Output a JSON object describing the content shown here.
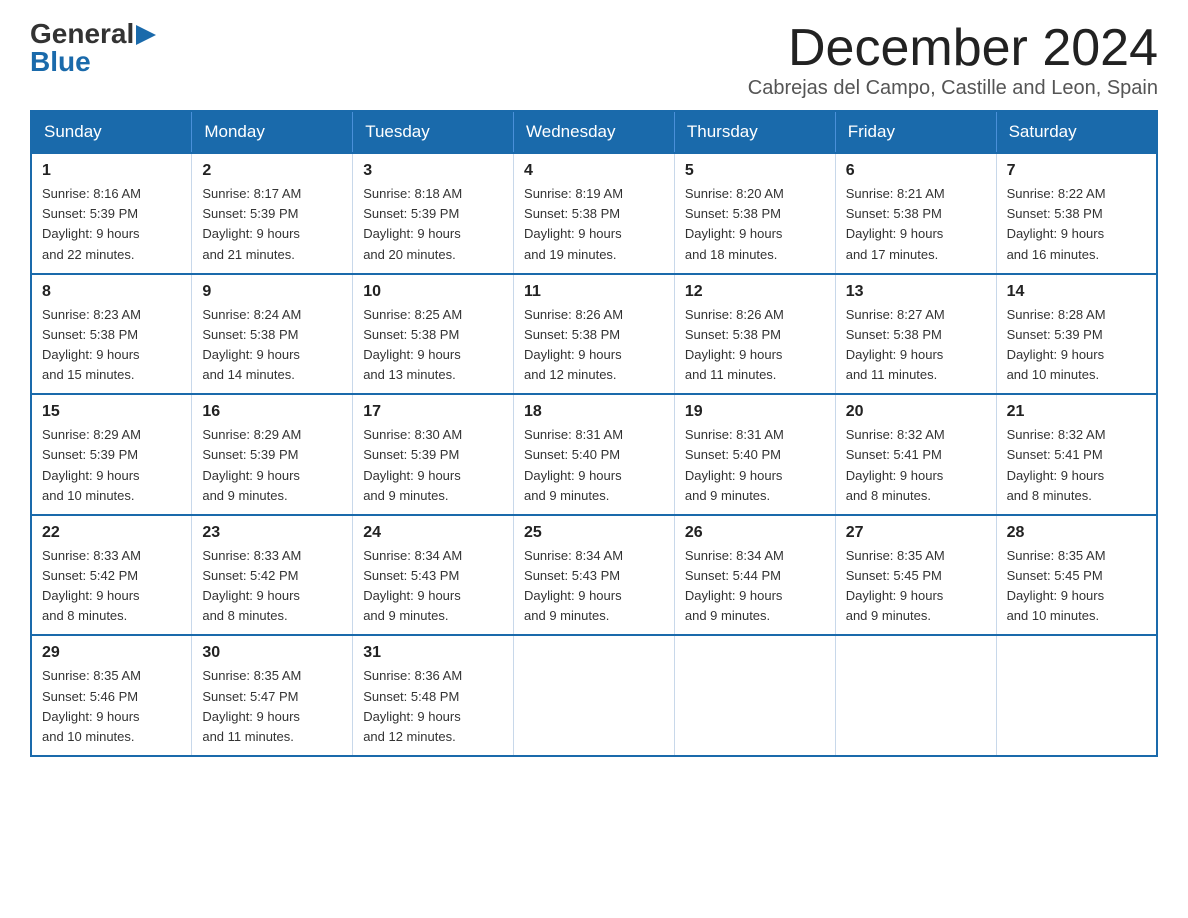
{
  "logo": {
    "general": "General",
    "blue": "Blue",
    "arrow": "▶"
  },
  "title": "December 2024",
  "location": "Cabrejas del Campo, Castille and Leon, Spain",
  "days_of_week": [
    "Sunday",
    "Monday",
    "Tuesday",
    "Wednesday",
    "Thursday",
    "Friday",
    "Saturday"
  ],
  "weeks": [
    [
      {
        "day": "1",
        "sunrise": "8:16 AM",
        "sunset": "5:39 PM",
        "daylight": "9 hours and 22 minutes."
      },
      {
        "day": "2",
        "sunrise": "8:17 AM",
        "sunset": "5:39 PM",
        "daylight": "9 hours and 21 minutes."
      },
      {
        "day": "3",
        "sunrise": "8:18 AM",
        "sunset": "5:39 PM",
        "daylight": "9 hours and 20 minutes."
      },
      {
        "day": "4",
        "sunrise": "8:19 AM",
        "sunset": "5:38 PM",
        "daylight": "9 hours and 19 minutes."
      },
      {
        "day": "5",
        "sunrise": "8:20 AM",
        "sunset": "5:38 PM",
        "daylight": "9 hours and 18 minutes."
      },
      {
        "day": "6",
        "sunrise": "8:21 AM",
        "sunset": "5:38 PM",
        "daylight": "9 hours and 17 minutes."
      },
      {
        "day": "7",
        "sunrise": "8:22 AM",
        "sunset": "5:38 PM",
        "daylight": "9 hours and 16 minutes."
      }
    ],
    [
      {
        "day": "8",
        "sunrise": "8:23 AM",
        "sunset": "5:38 PM",
        "daylight": "9 hours and 15 minutes."
      },
      {
        "day": "9",
        "sunrise": "8:24 AM",
        "sunset": "5:38 PM",
        "daylight": "9 hours and 14 minutes."
      },
      {
        "day": "10",
        "sunrise": "8:25 AM",
        "sunset": "5:38 PM",
        "daylight": "9 hours and 13 minutes."
      },
      {
        "day": "11",
        "sunrise": "8:26 AM",
        "sunset": "5:38 PM",
        "daylight": "9 hours and 12 minutes."
      },
      {
        "day": "12",
        "sunrise": "8:26 AM",
        "sunset": "5:38 PM",
        "daylight": "9 hours and 11 minutes."
      },
      {
        "day": "13",
        "sunrise": "8:27 AM",
        "sunset": "5:38 PM",
        "daylight": "9 hours and 11 minutes."
      },
      {
        "day": "14",
        "sunrise": "8:28 AM",
        "sunset": "5:39 PM",
        "daylight": "9 hours and 10 minutes."
      }
    ],
    [
      {
        "day": "15",
        "sunrise": "8:29 AM",
        "sunset": "5:39 PM",
        "daylight": "9 hours and 10 minutes."
      },
      {
        "day": "16",
        "sunrise": "8:29 AM",
        "sunset": "5:39 PM",
        "daylight": "9 hours and 9 minutes."
      },
      {
        "day": "17",
        "sunrise": "8:30 AM",
        "sunset": "5:39 PM",
        "daylight": "9 hours and 9 minutes."
      },
      {
        "day": "18",
        "sunrise": "8:31 AM",
        "sunset": "5:40 PM",
        "daylight": "9 hours and 9 minutes."
      },
      {
        "day": "19",
        "sunrise": "8:31 AM",
        "sunset": "5:40 PM",
        "daylight": "9 hours and 9 minutes."
      },
      {
        "day": "20",
        "sunrise": "8:32 AM",
        "sunset": "5:41 PM",
        "daylight": "9 hours and 8 minutes."
      },
      {
        "day": "21",
        "sunrise": "8:32 AM",
        "sunset": "5:41 PM",
        "daylight": "9 hours and 8 minutes."
      }
    ],
    [
      {
        "day": "22",
        "sunrise": "8:33 AM",
        "sunset": "5:42 PM",
        "daylight": "9 hours and 8 minutes."
      },
      {
        "day": "23",
        "sunrise": "8:33 AM",
        "sunset": "5:42 PM",
        "daylight": "9 hours and 8 minutes."
      },
      {
        "day": "24",
        "sunrise": "8:34 AM",
        "sunset": "5:43 PM",
        "daylight": "9 hours and 9 minutes."
      },
      {
        "day": "25",
        "sunrise": "8:34 AM",
        "sunset": "5:43 PM",
        "daylight": "9 hours and 9 minutes."
      },
      {
        "day": "26",
        "sunrise": "8:34 AM",
        "sunset": "5:44 PM",
        "daylight": "9 hours and 9 minutes."
      },
      {
        "day": "27",
        "sunrise": "8:35 AM",
        "sunset": "5:45 PM",
        "daylight": "9 hours and 9 minutes."
      },
      {
        "day": "28",
        "sunrise": "8:35 AM",
        "sunset": "5:45 PM",
        "daylight": "9 hours and 10 minutes."
      }
    ],
    [
      {
        "day": "29",
        "sunrise": "8:35 AM",
        "sunset": "5:46 PM",
        "daylight": "9 hours and 10 minutes."
      },
      {
        "day": "30",
        "sunrise": "8:35 AM",
        "sunset": "5:47 PM",
        "daylight": "9 hours and 11 minutes."
      },
      {
        "day": "31",
        "sunrise": "8:36 AM",
        "sunset": "5:48 PM",
        "daylight": "9 hours and 12 minutes."
      },
      null,
      null,
      null,
      null
    ]
  ],
  "labels": {
    "sunrise": "Sunrise:",
    "sunset": "Sunset:",
    "daylight": "Daylight:"
  }
}
